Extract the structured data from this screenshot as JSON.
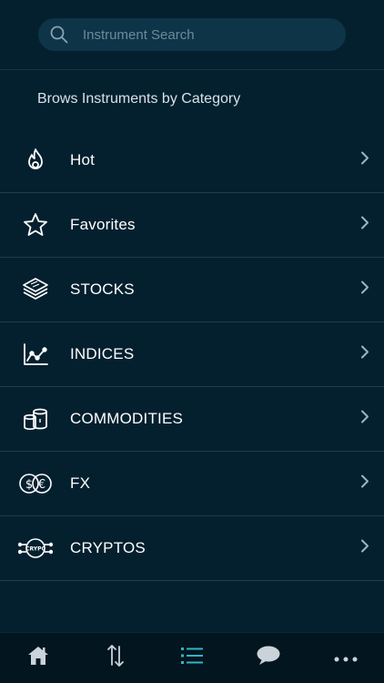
{
  "search": {
    "placeholder": "Instrument Search"
  },
  "section_title": "Brows Instruments by Category",
  "categories": [
    {
      "label": "Hot",
      "icon": "flame-icon"
    },
    {
      "label": "Favorites",
      "icon": "star-icon"
    },
    {
      "label": "STOCKS",
      "icon": "stacked-bills-icon"
    },
    {
      "label": "INDICES",
      "icon": "line-chart-icon"
    },
    {
      "label": "COMMODITIES",
      "icon": "barrels-icon"
    },
    {
      "label": "FX",
      "icon": "currency-exchange-icon"
    },
    {
      "label": "CRYPTOS",
      "icon": "crypto-coin-icon"
    }
  ],
  "bottom_nav": [
    {
      "name": "home",
      "icon": "home-icon",
      "active": false
    },
    {
      "name": "trade",
      "icon": "up-down-arrows-icon",
      "active": false
    },
    {
      "name": "instruments",
      "icon": "list-icon",
      "active": true
    },
    {
      "name": "chat",
      "icon": "chat-bubble-icon",
      "active": false
    },
    {
      "name": "more",
      "icon": "more-dots-icon",
      "active": false
    }
  ],
  "colors": {
    "background": "#04202f",
    "accent": "#2fb5c9",
    "icon": "#ffffff",
    "chevron": "#9fb3bf"
  }
}
